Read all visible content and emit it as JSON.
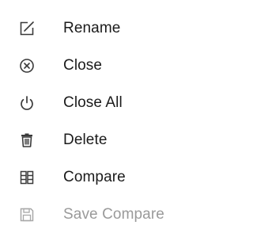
{
  "menu": {
    "items": [
      {
        "label": "Rename",
        "icon": "rename-icon",
        "enabled": true
      },
      {
        "label": "Close",
        "icon": "close-circle-icon",
        "enabled": true
      },
      {
        "label": "Close All",
        "icon": "power-icon",
        "enabled": true
      },
      {
        "label": "Delete",
        "icon": "trash-icon",
        "enabled": true
      },
      {
        "label": "Compare",
        "icon": "compare-icon",
        "enabled": true
      },
      {
        "label": "Save Compare",
        "icon": "save-icon",
        "enabled": false
      }
    ]
  },
  "colors": {
    "text": "#1b1b1b",
    "disabled_text": "#9a9a9a",
    "icon": "#3a3a3a",
    "disabled_icon": "#a8a8a8",
    "background": "#ffffff"
  }
}
